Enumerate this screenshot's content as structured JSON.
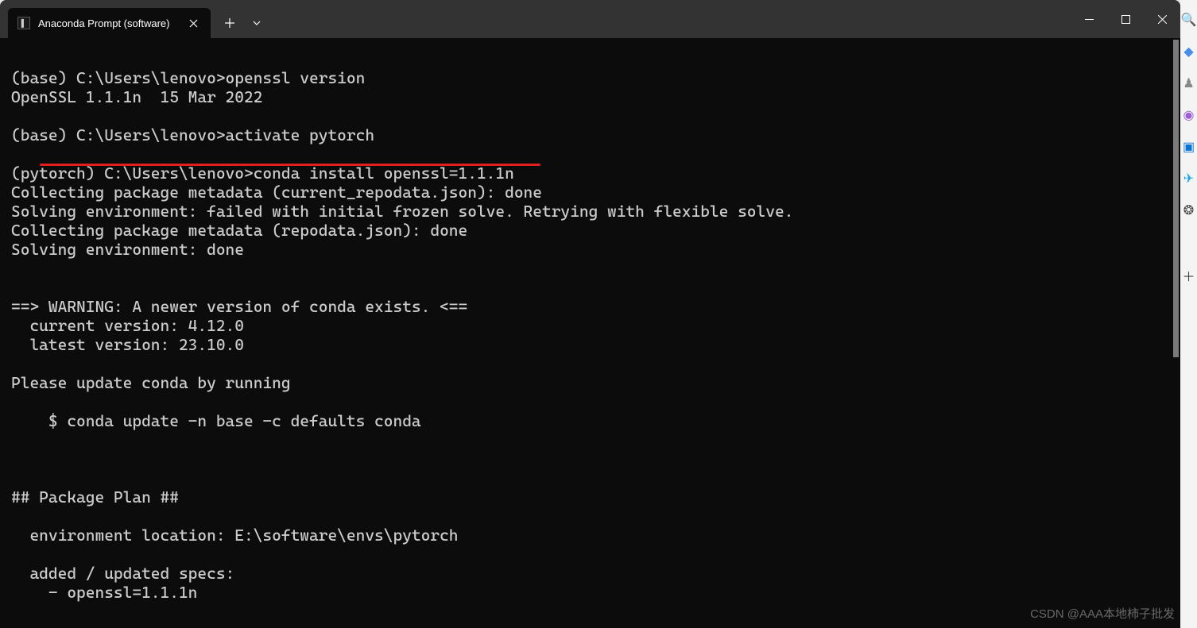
{
  "tab": {
    "title": "Anaconda Prompt (software)"
  },
  "terminal": {
    "lines": [
      "",
      "(base) C:\\Users\\lenovo>openssl version",
      "OpenSSL 1.1.1n  15 Mar 2022",
      "",
      "(base) C:\\Users\\lenovo>activate pytorch",
      "",
      "(pytorch) C:\\Users\\lenovo>conda install openssl=1.1.1n",
      "Collecting package metadata (current_repodata.json): done",
      "Solving environment: failed with initial frozen solve. Retrying with flexible solve.",
      "Collecting package metadata (repodata.json): done",
      "Solving environment: done",
      "",
      "",
      "==> WARNING: A newer version of conda exists. <==",
      "  current version: 4.12.0",
      "  latest version: 23.10.0",
      "",
      "Please update conda by running",
      "",
      "    $ conda update -n base -c defaults conda",
      "",
      "",
      "",
      "## Package Plan ##",
      "",
      "  environment location: E:\\software\\envs\\pytorch",
      "",
      "  added / updated specs:",
      "    - openssl=1.1.1n"
    ]
  },
  "watermark": "CSDN @AAA本地柿子批发",
  "sidebar_icons": [
    "search-icon",
    "cube-icon",
    "copilot-icon",
    "chat-icon",
    "outlook-icon",
    "paper-plane-icon",
    "openai-icon",
    "plus-icon"
  ]
}
